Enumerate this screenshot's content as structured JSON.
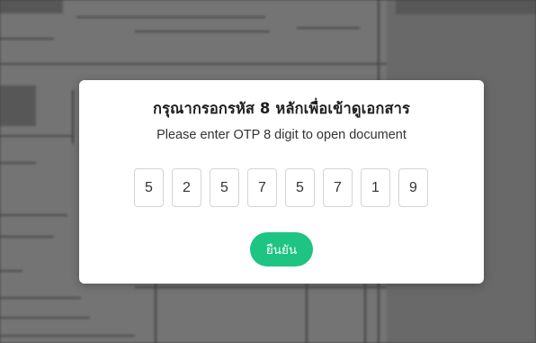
{
  "dialog": {
    "title": "กรุณากรอกรหัส 8 หลักเพื่อเข้าดูเอกสาร",
    "subtitle": "Please enter OTP 8 digit to open document",
    "otp_digits": [
      "5",
      "2",
      "5",
      "7",
      "5",
      "7",
      "1",
      "9"
    ],
    "confirm_label": "ยืนยัน"
  },
  "colors": {
    "accent": "#1ec482",
    "overlay": "#5a5a5a",
    "modal_bg": "#ffffff"
  }
}
